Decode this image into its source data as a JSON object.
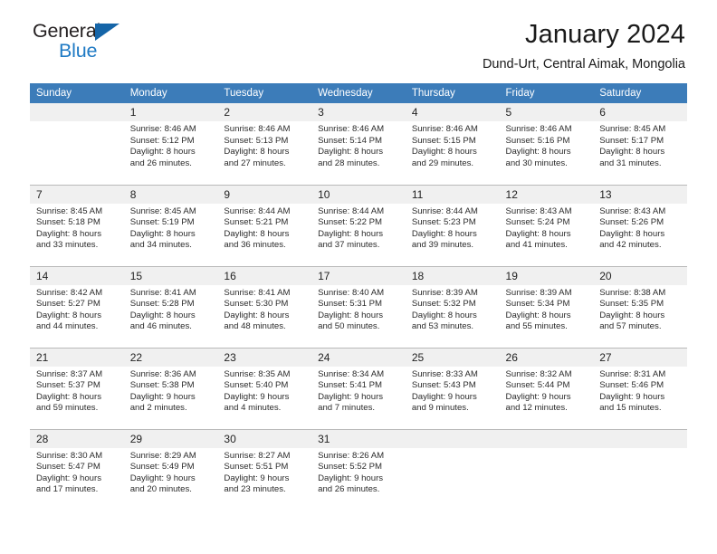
{
  "brand": {
    "name_top": "General",
    "name_bottom": "Blue",
    "color_dark": "#231f20",
    "color_blue": "#1f7ac4"
  },
  "header": {
    "title": "January 2024",
    "subtitle": "Dund-Urt, Central Aimak, Mongolia"
  },
  "calendar": {
    "header_bg": "#3c7cb9",
    "daynum_bg": "#f0f0f0",
    "weekdays": [
      "Sunday",
      "Monday",
      "Tuesday",
      "Wednesday",
      "Thursday",
      "Friday",
      "Saturday"
    ],
    "weeks": [
      [
        {
          "day": "",
          "sunrise": "",
          "sunset": "",
          "daylight_1": "",
          "daylight_2": ""
        },
        {
          "day": "1",
          "sunrise": "Sunrise: 8:46 AM",
          "sunset": "Sunset: 5:12 PM",
          "daylight_1": "Daylight: 8 hours",
          "daylight_2": "and 26 minutes."
        },
        {
          "day": "2",
          "sunrise": "Sunrise: 8:46 AM",
          "sunset": "Sunset: 5:13 PM",
          "daylight_1": "Daylight: 8 hours",
          "daylight_2": "and 27 minutes."
        },
        {
          "day": "3",
          "sunrise": "Sunrise: 8:46 AM",
          "sunset": "Sunset: 5:14 PM",
          "daylight_1": "Daylight: 8 hours",
          "daylight_2": "and 28 minutes."
        },
        {
          "day": "4",
          "sunrise": "Sunrise: 8:46 AM",
          "sunset": "Sunset: 5:15 PM",
          "daylight_1": "Daylight: 8 hours",
          "daylight_2": "and 29 minutes."
        },
        {
          "day": "5",
          "sunrise": "Sunrise: 8:46 AM",
          "sunset": "Sunset: 5:16 PM",
          "daylight_1": "Daylight: 8 hours",
          "daylight_2": "and 30 minutes."
        },
        {
          "day": "6",
          "sunrise": "Sunrise: 8:45 AM",
          "sunset": "Sunset: 5:17 PM",
          "daylight_1": "Daylight: 8 hours",
          "daylight_2": "and 31 minutes."
        }
      ],
      [
        {
          "day": "7",
          "sunrise": "Sunrise: 8:45 AM",
          "sunset": "Sunset: 5:18 PM",
          "daylight_1": "Daylight: 8 hours",
          "daylight_2": "and 33 minutes."
        },
        {
          "day": "8",
          "sunrise": "Sunrise: 8:45 AM",
          "sunset": "Sunset: 5:19 PM",
          "daylight_1": "Daylight: 8 hours",
          "daylight_2": "and 34 minutes."
        },
        {
          "day": "9",
          "sunrise": "Sunrise: 8:44 AM",
          "sunset": "Sunset: 5:21 PM",
          "daylight_1": "Daylight: 8 hours",
          "daylight_2": "and 36 minutes."
        },
        {
          "day": "10",
          "sunrise": "Sunrise: 8:44 AM",
          "sunset": "Sunset: 5:22 PM",
          "daylight_1": "Daylight: 8 hours",
          "daylight_2": "and 37 minutes."
        },
        {
          "day": "11",
          "sunrise": "Sunrise: 8:44 AM",
          "sunset": "Sunset: 5:23 PM",
          "daylight_1": "Daylight: 8 hours",
          "daylight_2": "and 39 minutes."
        },
        {
          "day": "12",
          "sunrise": "Sunrise: 8:43 AM",
          "sunset": "Sunset: 5:24 PM",
          "daylight_1": "Daylight: 8 hours",
          "daylight_2": "and 41 minutes."
        },
        {
          "day": "13",
          "sunrise": "Sunrise: 8:43 AM",
          "sunset": "Sunset: 5:26 PM",
          "daylight_1": "Daylight: 8 hours",
          "daylight_2": "and 42 minutes."
        }
      ],
      [
        {
          "day": "14",
          "sunrise": "Sunrise: 8:42 AM",
          "sunset": "Sunset: 5:27 PM",
          "daylight_1": "Daylight: 8 hours",
          "daylight_2": "and 44 minutes."
        },
        {
          "day": "15",
          "sunrise": "Sunrise: 8:41 AM",
          "sunset": "Sunset: 5:28 PM",
          "daylight_1": "Daylight: 8 hours",
          "daylight_2": "and 46 minutes."
        },
        {
          "day": "16",
          "sunrise": "Sunrise: 8:41 AM",
          "sunset": "Sunset: 5:30 PM",
          "daylight_1": "Daylight: 8 hours",
          "daylight_2": "and 48 minutes."
        },
        {
          "day": "17",
          "sunrise": "Sunrise: 8:40 AM",
          "sunset": "Sunset: 5:31 PM",
          "daylight_1": "Daylight: 8 hours",
          "daylight_2": "and 50 minutes."
        },
        {
          "day": "18",
          "sunrise": "Sunrise: 8:39 AM",
          "sunset": "Sunset: 5:32 PM",
          "daylight_1": "Daylight: 8 hours",
          "daylight_2": "and 53 minutes."
        },
        {
          "day": "19",
          "sunrise": "Sunrise: 8:39 AM",
          "sunset": "Sunset: 5:34 PM",
          "daylight_1": "Daylight: 8 hours",
          "daylight_2": "and 55 minutes."
        },
        {
          "day": "20",
          "sunrise": "Sunrise: 8:38 AM",
          "sunset": "Sunset: 5:35 PM",
          "daylight_1": "Daylight: 8 hours",
          "daylight_2": "and 57 minutes."
        }
      ],
      [
        {
          "day": "21",
          "sunrise": "Sunrise: 8:37 AM",
          "sunset": "Sunset: 5:37 PM",
          "daylight_1": "Daylight: 8 hours",
          "daylight_2": "and 59 minutes."
        },
        {
          "day": "22",
          "sunrise": "Sunrise: 8:36 AM",
          "sunset": "Sunset: 5:38 PM",
          "daylight_1": "Daylight: 9 hours",
          "daylight_2": "and 2 minutes."
        },
        {
          "day": "23",
          "sunrise": "Sunrise: 8:35 AM",
          "sunset": "Sunset: 5:40 PM",
          "daylight_1": "Daylight: 9 hours",
          "daylight_2": "and 4 minutes."
        },
        {
          "day": "24",
          "sunrise": "Sunrise: 8:34 AM",
          "sunset": "Sunset: 5:41 PM",
          "daylight_1": "Daylight: 9 hours",
          "daylight_2": "and 7 minutes."
        },
        {
          "day": "25",
          "sunrise": "Sunrise: 8:33 AM",
          "sunset": "Sunset: 5:43 PM",
          "daylight_1": "Daylight: 9 hours",
          "daylight_2": "and 9 minutes."
        },
        {
          "day": "26",
          "sunrise": "Sunrise: 8:32 AM",
          "sunset": "Sunset: 5:44 PM",
          "daylight_1": "Daylight: 9 hours",
          "daylight_2": "and 12 minutes."
        },
        {
          "day": "27",
          "sunrise": "Sunrise: 8:31 AM",
          "sunset": "Sunset: 5:46 PM",
          "daylight_1": "Daylight: 9 hours",
          "daylight_2": "and 15 minutes."
        }
      ],
      [
        {
          "day": "28",
          "sunrise": "Sunrise: 8:30 AM",
          "sunset": "Sunset: 5:47 PM",
          "daylight_1": "Daylight: 9 hours",
          "daylight_2": "and 17 minutes."
        },
        {
          "day": "29",
          "sunrise": "Sunrise: 8:29 AM",
          "sunset": "Sunset: 5:49 PM",
          "daylight_1": "Daylight: 9 hours",
          "daylight_2": "and 20 minutes."
        },
        {
          "day": "30",
          "sunrise": "Sunrise: 8:27 AM",
          "sunset": "Sunset: 5:51 PM",
          "daylight_1": "Daylight: 9 hours",
          "daylight_2": "and 23 minutes."
        },
        {
          "day": "31",
          "sunrise": "Sunrise: 8:26 AM",
          "sunset": "Sunset: 5:52 PM",
          "daylight_1": "Daylight: 9 hours",
          "daylight_2": "and 26 minutes."
        },
        {
          "day": "",
          "sunrise": "",
          "sunset": "",
          "daylight_1": "",
          "daylight_2": ""
        },
        {
          "day": "",
          "sunrise": "",
          "sunset": "",
          "daylight_1": "",
          "daylight_2": ""
        },
        {
          "day": "",
          "sunrise": "",
          "sunset": "",
          "daylight_1": "",
          "daylight_2": ""
        }
      ]
    ]
  }
}
